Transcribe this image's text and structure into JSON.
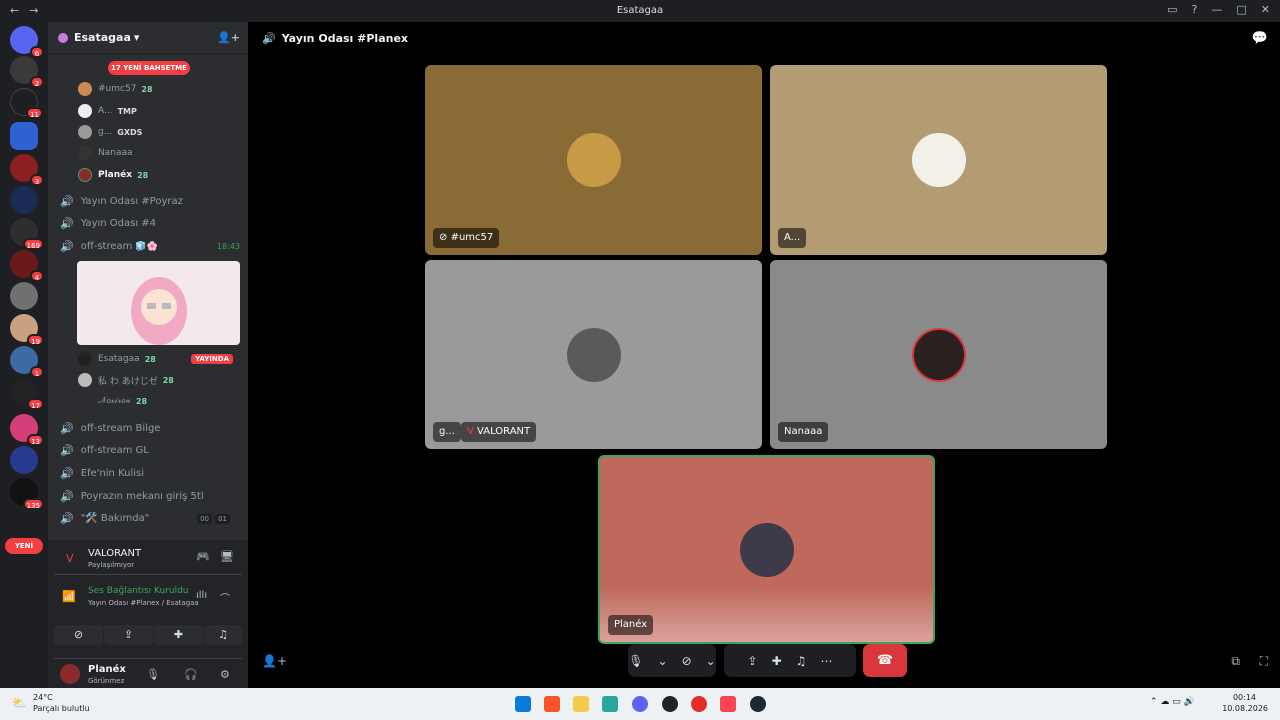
{
  "window": {
    "title": "Esatagaa",
    "back": "←",
    "forward": "→"
  },
  "servers": {
    "badges": [
      "6",
      "2",
      "11",
      "3",
      "7",
      "",
      "169",
      "4",
      "",
      "19",
      "1",
      "17",
      "13",
      "135"
    ],
    "new_label": "YENİ"
  },
  "guild": {
    "name": "Esatagaa",
    "mention_pill": "17 YENİ BAHSETME"
  },
  "voice_top": [
    {
      "name": "#umc57",
      "level": "28"
    },
    {
      "name": "A...",
      "level": "TMP"
    },
    {
      "name": "g...",
      "level": "GXDS"
    },
    {
      "name": "Nanaaa",
      "level": ""
    },
    {
      "name": "Planéx",
      "level": "28"
    }
  ],
  "channels_a": [
    "Yayın Odası #Poyraz",
    "Yayın Odası #4"
  ],
  "off_stream": {
    "name": "off-stream",
    "time": "18:43"
  },
  "stream_members": [
    {
      "name": "Esatagaa",
      "level": "28",
      "badge": "YAYINDA"
    },
    {
      "name": "私 わ あけじゼ",
      "level": "28"
    },
    {
      "name": "𝒩𝑜𝓍𝒾𝓇𝑜𝓃",
      "level": "28"
    }
  ],
  "channels_b": [
    "off-stream Bilge",
    "off-stream GL",
    "Efe'nin Kulisi",
    "Poyrazın mekanı giriş 5tl"
  ],
  "bakimda": {
    "name": "\"🛠️ Bakımda\"",
    "c1": "00",
    "c2": "01"
  },
  "activity": {
    "game": "VALORANT",
    "status": "Paylaşılmıyor"
  },
  "voice_status": {
    "title": "Ses Bağlantısı Kuruldu",
    "subtitle": "Yayın Odası #Planex / Esatagaa"
  },
  "user": {
    "name": "Planéx",
    "status": "Görünmez"
  },
  "call": {
    "channel": "Yayın Odası #Planex",
    "tiles": [
      {
        "label": "#umc57",
        "bg": "#8a6a35",
        "avatar": "#c79a45"
      },
      {
        "label": "A...",
        "bg": "#b39c74",
        "avatar": "#f3f0ea"
      },
      {
        "label": "g...",
        "bg": "#9a9a9a",
        "avatar": "#5a5a5a",
        "activity": "VALORANT"
      },
      {
        "label": "Nanaaa",
        "bg": "#8a8a8a",
        "avatar": "#2a2020"
      },
      {
        "label": "Planéx",
        "bg": "#c0685c",
        "avatar": "#3d3a4a"
      }
    ]
  },
  "taskbar": {
    "weather_temp": "24°C",
    "weather_desc": "Parçalı bulutlu",
    "time": "00:14",
    "date": "10.08.2026"
  }
}
